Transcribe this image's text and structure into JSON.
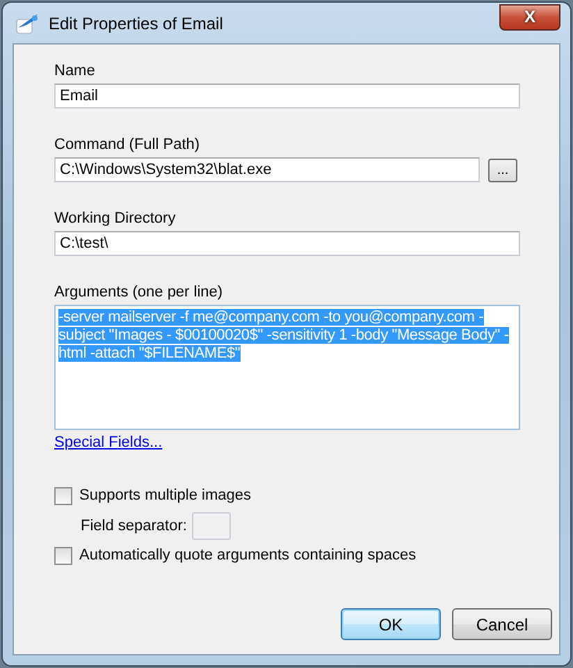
{
  "window": {
    "title": "Edit Properties of Email",
    "close_label": "X"
  },
  "fields": [
    {
      "label": "Name",
      "value": "Email",
      "browse": false
    },
    {
      "label": "Command (Full Path)",
      "value": "C:\\Windows\\System32\\blat.exe",
      "browse": true,
      "browse_label": "..."
    },
    {
      "label": "Working Directory",
      "value": "C:\\test\\",
      "browse": false
    }
  ],
  "arguments": {
    "label": "Arguments (one per line)",
    "value": "-server mailserver -f me@company.com -to you@company.com -subject \"Images - $00100020$\" -sensitivity 1 -body \"Message Body\" -html -attach \"$FILENAME$\"",
    "selected": true
  },
  "special_fields_link": "Special Fields...",
  "options": [
    {
      "kind": "checkbox",
      "label": "Supports multiple images",
      "checked": false
    },
    {
      "kind": "field",
      "label": "Field separator:"
    },
    {
      "kind": "checkbox",
      "label": "Automatically quote arguments containing spaces",
      "checked": false
    }
  ],
  "buttons": [
    {
      "label": "OK",
      "default": true
    },
    {
      "label": "Cancel",
      "default": false
    }
  ]
}
